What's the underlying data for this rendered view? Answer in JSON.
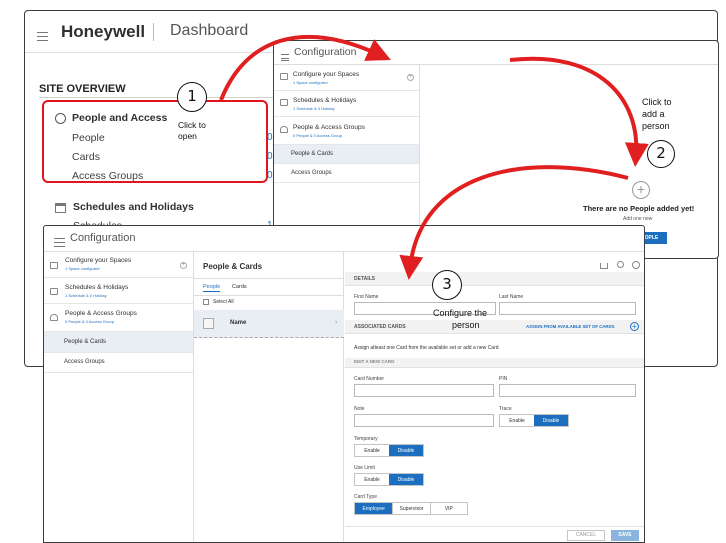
{
  "dashboard": {
    "brand": "Honeywell",
    "title": "Dashboard",
    "section": "SITE OVERVIEW",
    "people_access": {
      "heading": "People and Access",
      "rows": [
        {
          "label": "People",
          "count": "0"
        },
        {
          "label": "Cards",
          "count": "0"
        },
        {
          "label": "Access Groups",
          "count": "0"
        }
      ]
    },
    "schedules": {
      "heading": "Schedules and Holidays",
      "rows": [
        {
          "label": "Schedules",
          "count": "1"
        }
      ]
    }
  },
  "config_top": {
    "title": "Configuration",
    "items": [
      {
        "title": "Configure your Spaces",
        "sub": "1 Space configured"
      },
      {
        "title": "Schedules & Holidays",
        "sub": "1 Schedule & 0 Holiday"
      },
      {
        "title": "People & Access Groups",
        "sub": "0 People & 0 Access Group"
      },
      {
        "title": "People & Cards",
        "sub": ""
      },
      {
        "title": "Access Groups",
        "sub": ""
      }
    ],
    "empty_title": "There are no People added yet!",
    "empty_sub": "Add one now",
    "add_button": "ADD PEOPLE"
  },
  "config_bottom": {
    "title": "Configuration",
    "items": [
      {
        "title": "Configure your Spaces",
        "sub": "1 Space configured"
      },
      {
        "title": "Schedules & Holidays",
        "sub": "1 Schedule & 0 Holiday"
      },
      {
        "title": "People & Access Groups",
        "sub": "0 People & 0 Access Group"
      },
      {
        "title": "People & Cards",
        "sub": ""
      },
      {
        "title": "Access Groups",
        "sub": ""
      }
    ],
    "list": {
      "header": "People & Cards",
      "tabs": [
        "People",
        "Cards"
      ],
      "select_all": "Select All",
      "name_label": "Name"
    },
    "details": {
      "section": "DETAILS",
      "first_name": "First Name",
      "last_name": "Last Name",
      "assoc_cards": "ASSOCIATED CARDS",
      "assign_link": "ASSIGN FROM AVAILABLE SET OF CARDS",
      "assign_text": "Assign atleast one Card from the available set or add a new Card",
      "new_card": "EDIT A NEW CARD",
      "card_number": "Card Number",
      "pin": "PIN",
      "note": "Note",
      "trace": "Trace",
      "temporary": "Temporary",
      "use_limit": "Use Limit",
      "card_type": "Card Type",
      "enable": "Enable",
      "disable": "Disable",
      "types": [
        "Employee",
        "Supervisor",
        "VIP"
      ],
      "cancel": "CANCEL",
      "save": "SAVE"
    }
  },
  "annotations": {
    "step1": "1",
    "step1_text": [
      "Click  to",
      "open"
    ],
    "step2": "2",
    "step2_text": [
      "Click  to",
      "add  a",
      "person"
    ],
    "step3": "3",
    "step3_text": [
      "Configure   the",
      "person"
    ]
  },
  "colors": {
    "accent": "#1c6fbf",
    "callout_red": "#e0161d",
    "arrow_red": "#e02020",
    "selected_bg": "#e9eef4"
  }
}
